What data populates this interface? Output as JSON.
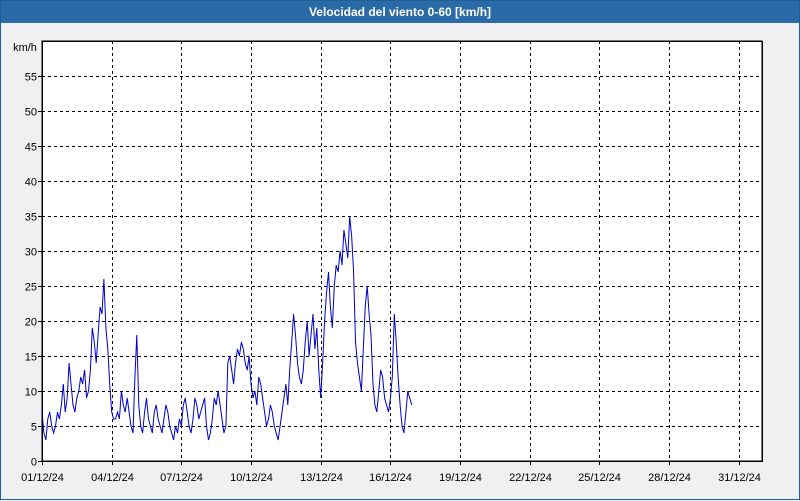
{
  "window": {
    "title": "Velocidad del viento 0-60 [km/h]"
  },
  "chart_data": {
    "type": "line",
    "title": "Velocidad del viento 0-60 [km/h]",
    "ylabel": "km/h",
    "xlabel": "",
    "ylim": [
      0,
      60
    ],
    "xlim": [
      "2024-12-01",
      "2025-01-01"
    ],
    "yticks": [
      0,
      5,
      10,
      15,
      20,
      25,
      30,
      35,
      40,
      45,
      50,
      55
    ],
    "xticks": [
      "01/12/24",
      "04/12/24",
      "07/12/24",
      "10/12/24",
      "13/12/24",
      "16/12/24",
      "19/12/24",
      "22/12/24",
      "25/12/24",
      "28/12/24",
      "31/12/24"
    ],
    "grid": true,
    "line_color": "#0000c8",
    "series": [
      {
        "x": [
          "2024-12-01",
          "2024-12-02",
          "2024-12-03",
          "2024-12-04",
          "2024-12-05",
          "2024-12-06",
          "2024-12-07",
          "2024-12-08",
          "2024-12-09",
          "2024-12-10",
          "2024-12-11",
          "2024-12-12",
          "2024-12-13",
          "2024-12-14",
          "2024-12-15",
          "2024-12-16",
          "2024-12-17",
          "2024-12-18",
          "2024-12-19",
          "2024-12-20",
          "2024-12-21",
          "2024-12-22",
          "2024-12-23",
          "2024-12-24",
          "2024-12-25",
          "2024-12-26",
          "2024-12-27",
          "2024-12-28",
          "2024-12-29",
          "2024-12-30",
          "2024-12-31",
          "2025-01-01"
        ],
        "values": [
          [
            7,
            4,
            3,
            6,
            7,
            5,
            4,
            5,
            7,
            6,
            8,
            11
          ],
          [
            7,
            9,
            14,
            11,
            8,
            7,
            9,
            10,
            12,
            11,
            13,
            9
          ],
          [
            10,
            13,
            19,
            17,
            14,
            18,
            22,
            21,
            26,
            19,
            16,
            11
          ],
          [
            7,
            6,
            6,
            7,
            6,
            10,
            8,
            7,
            9,
            7,
            5,
            4
          ],
          [
            12,
            18,
            8,
            5,
            4,
            7,
            9,
            6,
            5,
            4,
            7,
            8
          ],
          [
            6,
            5,
            4,
            6,
            8,
            7,
            5,
            4,
            3,
            5,
            4,
            6
          ],
          [
            5,
            8,
            9,
            7,
            5,
            4,
            6,
            9,
            8,
            6,
            7,
            8
          ],
          [
            9,
            5,
            3,
            4,
            6,
            9,
            8,
            10,
            8,
            6,
            4,
            5
          ],
          [
            14,
            15,
            13,
            11,
            14,
            16,
            15,
            17,
            16,
            14,
            13,
            15
          ],
          [
            11,
            9,
            10,
            8,
            12,
            11,
            9,
            7,
            5,
            6,
            8,
            7
          ],
          [
            5,
            4,
            3,
            5,
            7,
            9,
            11,
            8,
            13,
            17,
            21,
            18
          ],
          [
            14,
            12,
            11,
            13,
            17,
            20,
            15,
            18,
            21,
            16,
            19,
            13
          ],
          [
            9,
            14,
            20,
            24,
            27,
            22,
            19,
            25,
            28,
            27,
            30,
            28
          ],
          [
            33,
            31,
            29,
            35,
            32,
            27,
            17,
            14,
            12,
            10,
            16,
            22
          ],
          [
            25,
            21,
            18,
            11,
            8,
            7,
            10,
            13,
            12,
            9,
            8,
            7
          ],
          [
            9,
            12,
            21,
            17,
            12,
            8,
            5,
            4,
            7,
            10,
            9,
            8
          ]
        ]
      }
    ]
  }
}
